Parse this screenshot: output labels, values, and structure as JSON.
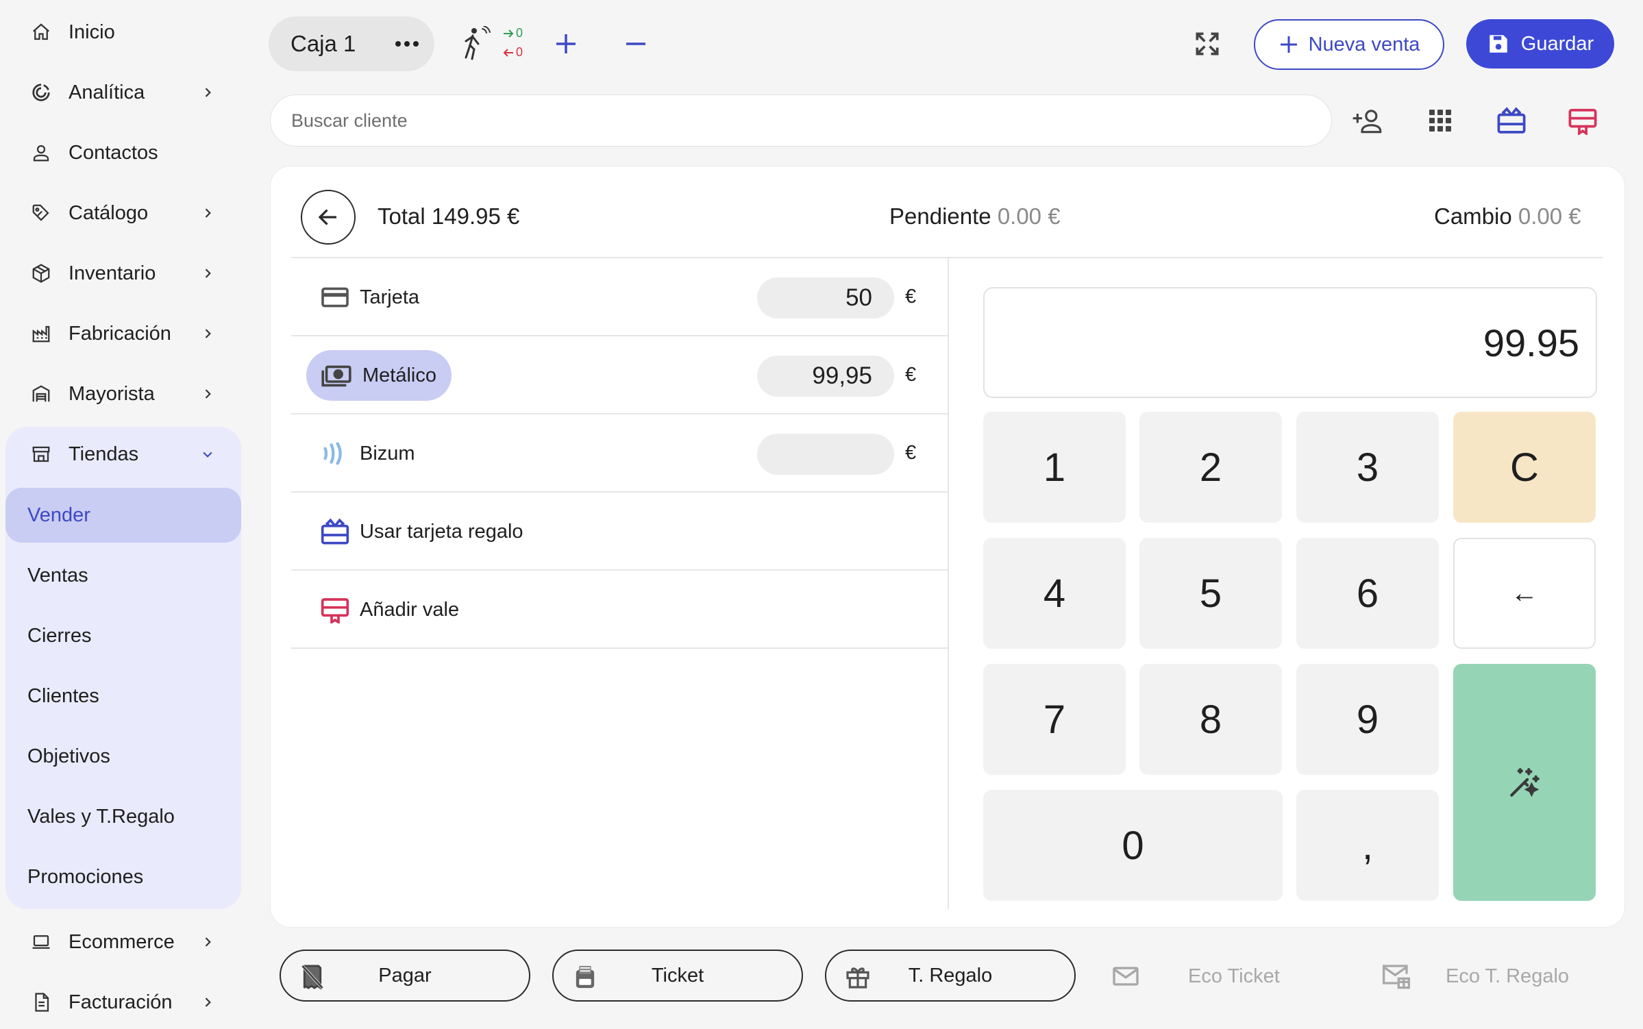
{
  "sidebar": {
    "items": [
      {
        "label": "Inicio",
        "icon": "home-icon"
      },
      {
        "label": "Analítica",
        "icon": "analytics-icon"
      },
      {
        "label": "Contactos",
        "icon": "contacts-icon"
      },
      {
        "label": "Catálogo",
        "icon": "tag-icon"
      },
      {
        "label": "Inventario",
        "icon": "box-icon"
      },
      {
        "label": "Fabricación",
        "icon": "factory-icon"
      },
      {
        "label": "Mayorista",
        "icon": "warehouse-icon"
      },
      {
        "label": "Tiendas",
        "icon": "store-icon"
      },
      {
        "label": "Ecommerce",
        "icon": "laptop-icon"
      },
      {
        "label": "Facturación",
        "icon": "invoice-icon"
      }
    ],
    "tiendas_sub": [
      "Vender",
      "Ventas",
      "Cierres",
      "Clientes",
      "Objetivos",
      "Vales y T.Regalo",
      "Promociones"
    ],
    "active_sub": "Vender"
  },
  "topbar": {
    "register_name": "Caja 1",
    "visitors_in": "0",
    "visitors_out": "0",
    "new_sale_label": "Nueva venta",
    "save_label": "Guardar"
  },
  "search": {
    "placeholder": "Buscar cliente",
    "value": ""
  },
  "summary": {
    "total_label": "Total",
    "total_value": "149.95 €",
    "pending_label": "Pendiente",
    "pending_value": "0.00 €",
    "change_label": "Cambio",
    "change_value": "0.00 €"
  },
  "payment_methods": [
    {
      "label": "Tarjeta",
      "amount": "50",
      "currency": "€",
      "icon": "credit-card-icon"
    },
    {
      "label": "Metálico",
      "amount": "99,95",
      "currency": "€",
      "icon": "cash-icon"
    },
    {
      "label": "Bizum",
      "amount": "",
      "currency": "€",
      "icon": "bizum-icon"
    },
    {
      "label": "Usar tarjeta regalo",
      "icon": "gift-card-icon"
    },
    {
      "label": "Añadir vale",
      "icon": "voucher-icon"
    }
  ],
  "keypad": {
    "display": "99.95",
    "keys": [
      "1",
      "2",
      "3",
      "4",
      "5",
      "6",
      "7",
      "8",
      "9",
      "0",
      ","
    ],
    "clear": "C",
    "backspace": "←"
  },
  "bottom_actions": [
    {
      "label": "Pagar",
      "icon": "receipt-off-icon"
    },
    {
      "label": "Ticket",
      "icon": "printer-icon"
    },
    {
      "label": "T. Regalo",
      "icon": "gift-icon"
    },
    {
      "label": "Eco Ticket",
      "icon": "mail-icon"
    },
    {
      "label": "Eco T. Regalo",
      "icon": "mail-gift-icon"
    }
  ],
  "colors": {
    "accent": "#3d49c4",
    "accent_dark": "#3d49d6",
    "sidebar_group_bg": "#e9eafb",
    "selected_bg": "#c9ccf3",
    "clear_key": "#f7e6c6",
    "confirm_key": "#96d4b6",
    "voucher_red": "#d6335a",
    "in_green": "#2e9e55",
    "out_red": "#d9343e"
  }
}
